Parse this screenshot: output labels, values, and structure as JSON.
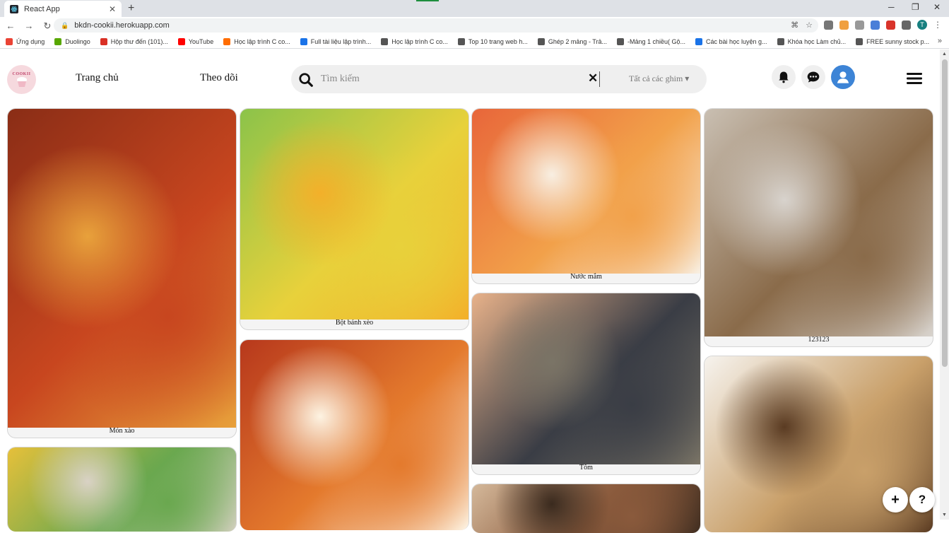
{
  "browser": {
    "tab_title": "React App",
    "tab_close": "✕",
    "new_tab": "+",
    "url": "bkdn-cookii.herokuapp.com",
    "window_controls": {
      "minimize": "─",
      "maximize": "❐",
      "close": "✕"
    },
    "bookmarks": [
      {
        "label": "Ứng dụng",
        "color": "#ea4335"
      },
      {
        "label": "Duolingo",
        "color": "#58a700"
      },
      {
        "label": "Hộp thư đến (101)...",
        "color": "#d93025"
      },
      {
        "label": "YouTube",
        "color": "#ff0000"
      },
      {
        "label": "Học lập trình C co...",
        "color": "#ff6d00"
      },
      {
        "label": "Full tài liệu lập trình...",
        "color": "#1a73e8"
      },
      {
        "label": "Học lập trình C co...",
        "color": "#555555"
      },
      {
        "label": "Top 10 trang web h...",
        "color": "#555555"
      },
      {
        "label": "Ghép 2 mảng - Trả...",
        "color": "#555555"
      },
      {
        "label": "-Mảng 1 chiều( Gộ...",
        "color": "#555555"
      },
      {
        "label": "Các bài học luyện g...",
        "color": "#1a73e8"
      },
      {
        "label": "Khóa học Làm chủ...",
        "color": "#555555"
      },
      {
        "label": "FREE sunny stock p...",
        "color": "#555555"
      }
    ],
    "bookmarks_more": "»",
    "profile_initial": "T"
  },
  "header": {
    "logo_text": "COOKII",
    "nav_home": "Trang chủ",
    "nav_follow": "Theo dõi",
    "search_placeholder": "Tìm kiếm",
    "search_clear": "✕",
    "filter_label": "Tất cả các ghim ▾"
  },
  "pins": [
    {
      "id": "pin-1",
      "caption": "Món xào",
      "colors": [
        "#c8461f",
        "#8a2d16",
        "#e8a13b"
      ]
    },
    {
      "id": "pin-2",
      "caption": "",
      "colors": [
        "#6aa84f",
        "#e6c03a",
        "#d9d2c5"
      ]
    },
    {
      "id": "pin-3",
      "caption": "Bột bánh xèo",
      "colors": [
        "#e8d13b",
        "#8bc34a",
        "#f3b02a"
      ]
    },
    {
      "id": "pin-4",
      "caption": "",
      "colors": [
        "#e47a2d",
        "#b7381c",
        "#fdf3e2"
      ]
    },
    {
      "id": "pin-5",
      "caption": "Nước mắm",
      "colors": [
        "#f2a14a",
        "#e8663a",
        "#f8efe2"
      ]
    },
    {
      "id": "pin-6",
      "caption": "Tôm",
      "colors": [
        "#3a3d45",
        "#e8b28a",
        "#7a7466"
      ]
    },
    {
      "id": "pin-7",
      "caption": "",
      "colors": [
        "#8a5a3c",
        "#d4b89a",
        "#3a2a1e"
      ]
    },
    {
      "id": "pin-8",
      "caption": "123123",
      "colors": [
        "#8a6b4a",
        "#c9bfb2",
        "#d8d3cd"
      ]
    },
    {
      "id": "pin-9",
      "caption": "",
      "colors": [
        "#c9a06a",
        "#f6f3ee",
        "#5a3b22"
      ]
    }
  ],
  "fab": {
    "add": "+",
    "help": "?"
  }
}
